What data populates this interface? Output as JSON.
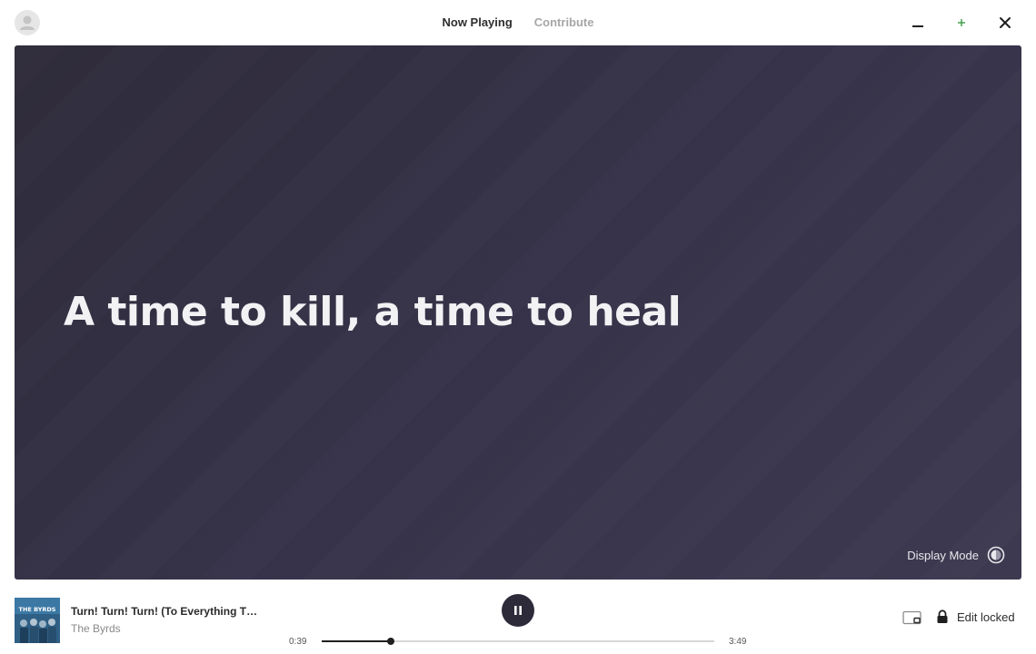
{
  "header": {
    "tabs": [
      {
        "label": "Now Playing",
        "active": true
      },
      {
        "label": "Contribute",
        "active": false
      }
    ],
    "window_buttons": [
      "minimize-icon",
      "plus-icon",
      "close-icon"
    ],
    "accent_color": "#3a9d46"
  },
  "lyrics": {
    "current_line": "A time to kill, a time to heal",
    "display_mode_label": "Display Mode",
    "background_color": "#37334a"
  },
  "player": {
    "album_art_text": "THE BYRDS",
    "track_title": "Turn! Turn! Turn! (To Everything Th...",
    "artist": "The Byrds",
    "state": "playing",
    "elapsed": "0:39",
    "duration": "3:49",
    "progress": 0.177,
    "edit_lock_label": "Edit locked"
  }
}
